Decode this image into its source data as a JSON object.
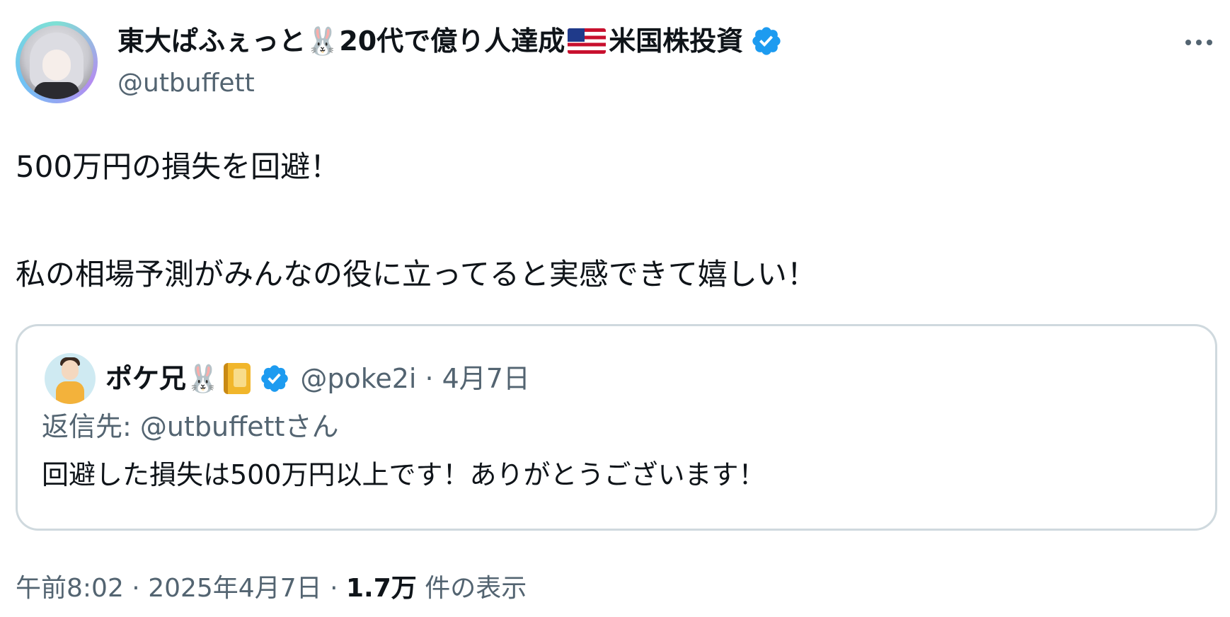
{
  "author": {
    "name_part1": "東大ぱふぇっと",
    "name_part2": "20代で億り人達成",
    "name_part3": "米国株投資",
    "rabbit_icon": "🐰",
    "flag_icon": "us-flag",
    "verified_icon": "verified-badge",
    "handle": "@utbuffett"
  },
  "tweet": {
    "line1": "500万円の損失を回避！",
    "line2": "私の相場予測がみんなの役に立ってると実感できて嬉しい！"
  },
  "quote": {
    "name": "ポケ兄",
    "rabbit_icon": "🐰",
    "notebook_icon": "notebook-icon",
    "handle": "@poke2i",
    "separator": "·",
    "date": "4月7日",
    "reply_prefix": "返信先: ",
    "reply_mention": "@utbuffettさん",
    "text": "回避した損失は500万円以上です！ありがとうございます！"
  },
  "meta": {
    "time": "午前8:02",
    "sep1": " · ",
    "date": "2025年4月7日",
    "sep2": " · ",
    "views_count": "1.7万",
    "views_label": " 件の表示"
  },
  "colors": {
    "text": "#0f1419",
    "secondary": "#536471",
    "verified": "#1d9bf0",
    "border": "#cfd9de"
  }
}
